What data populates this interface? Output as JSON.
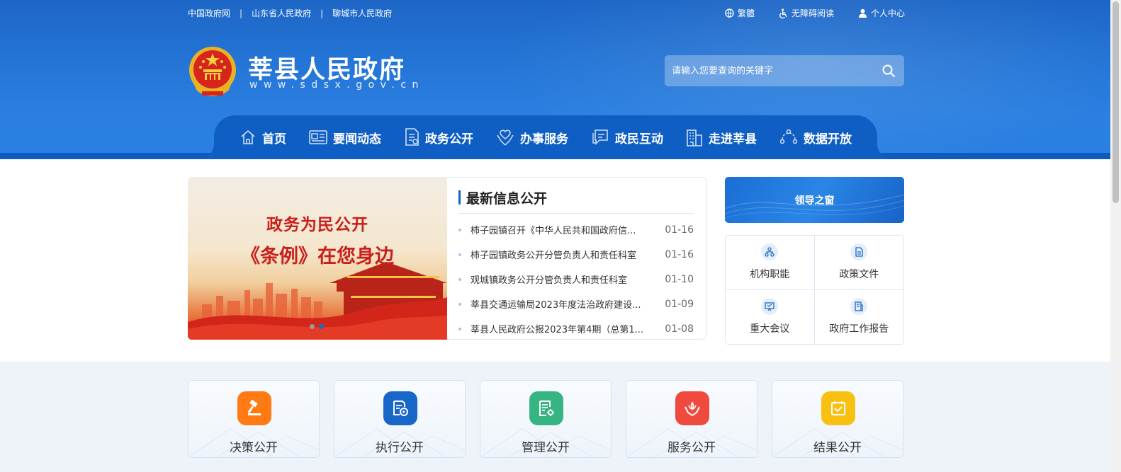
{
  "colors": {
    "header_blue": "#1d66c6",
    "nav_blue": "#0f5ec4",
    "accent": "#1161c6"
  },
  "topbar": {
    "links": [
      "中国政府网",
      "山东省人民政府",
      "聊城市人民政府"
    ],
    "separator": "|",
    "tools": [
      {
        "icon": "globe-icon",
        "label": "繁體"
      },
      {
        "icon": "accessibility-icon",
        "label": "无障碍阅读"
      },
      {
        "icon": "user-icon",
        "label": "个人中心"
      }
    ]
  },
  "site": {
    "title": "莘县人民政府",
    "url": "www.sdsx.gov.cn"
  },
  "search": {
    "placeholder": "请输入您要查询的关键字",
    "icon": "search-icon"
  },
  "nav": [
    {
      "label": "首页",
      "icon": "home-icon"
    },
    {
      "label": "要闻动态",
      "icon": "newspaper-icon"
    },
    {
      "label": "政务公开",
      "icon": "document-icon"
    },
    {
      "label": "办事服务",
      "icon": "hands-icon"
    },
    {
      "label": "政民互动",
      "icon": "chat-icon"
    },
    {
      "label": "走进莘县",
      "icon": "building-icon"
    },
    {
      "label": "数据开放",
      "icon": "data-icon"
    }
  ],
  "banner": {
    "line1": "政务为民公开",
    "line2": "《条例》在您身边",
    "slide_count": 2,
    "active_slide": 2
  },
  "news": {
    "title": "最新信息公开",
    "items": [
      {
        "text": "柿子园镇召开《中华人民共和国政府信...",
        "date": "01-16"
      },
      {
        "text": "柿子园镇政务公开分管负责人和责任科室",
        "date": "01-16"
      },
      {
        "text": "观城镇政务公开分管负责人和责任科室",
        "date": "01-10"
      },
      {
        "text": "莘县交通运输局2023年度法治政府建设...",
        "date": "01-09"
      },
      {
        "text": "莘县人民政府公报2023年第4期（总第1...",
        "date": "01-08"
      }
    ]
  },
  "leader": {
    "label": "领导之窗"
  },
  "quicklinks": [
    {
      "label": "机构职能",
      "icon": "org-chart-icon"
    },
    {
      "label": "政策文件",
      "icon": "file-icon"
    },
    {
      "label": "重大会议",
      "icon": "meeting-icon"
    },
    {
      "label": "政府工作报告",
      "icon": "report-icon"
    }
  ],
  "cards": [
    {
      "label": "决策公开",
      "icon": "gavel-icon",
      "color": "#ff7a12"
    },
    {
      "label": "执行公开",
      "icon": "execute-icon",
      "color": "#1767c9"
    },
    {
      "label": "管理公开",
      "icon": "manage-icon",
      "color": "#36b583"
    },
    {
      "label": "服务公开",
      "icon": "service-icon",
      "color": "#f04a3e"
    },
    {
      "label": "结果公开",
      "icon": "result-icon",
      "color": "#f8c112"
    }
  ]
}
